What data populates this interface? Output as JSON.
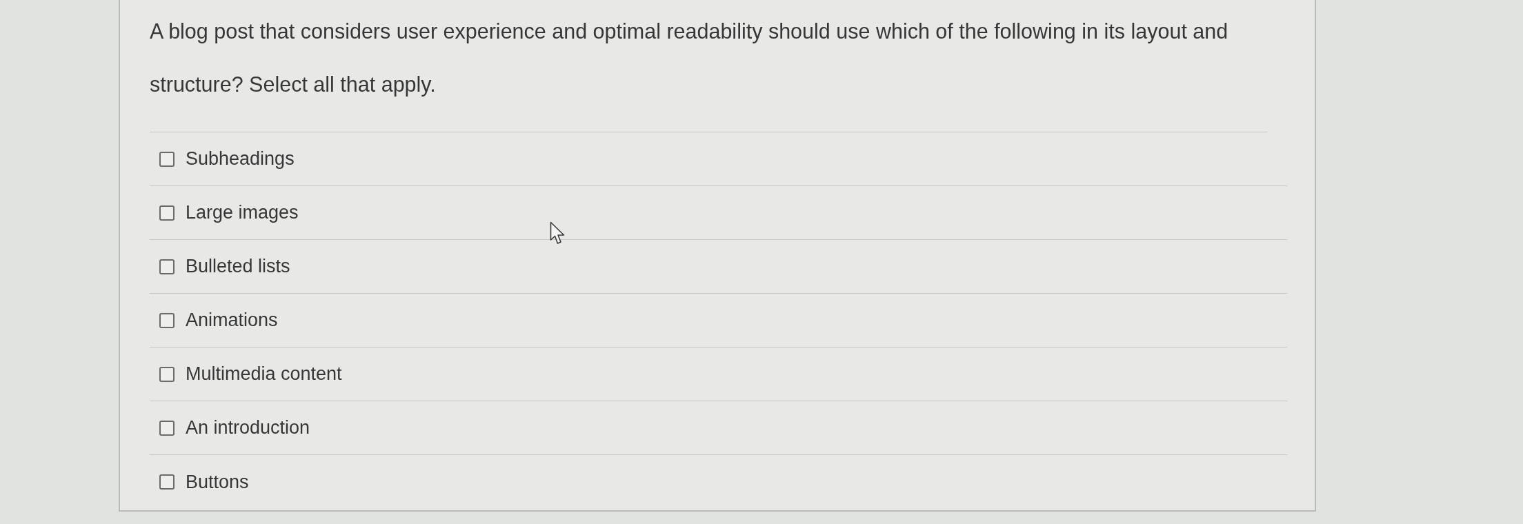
{
  "question": {
    "text": "A blog post that considers user experience and optimal readability should use which of the following in its layout and structure? Select all that apply."
  },
  "options": [
    {
      "label": "Subheadings",
      "checked": false
    },
    {
      "label": "Large images",
      "checked": false
    },
    {
      "label": "Bulleted lists",
      "checked": false
    },
    {
      "label": "Animations",
      "checked": false
    },
    {
      "label": "Multimedia content",
      "checked": false
    },
    {
      "label": "An introduction",
      "checked": false
    },
    {
      "label": "Buttons",
      "checked": false
    }
  ]
}
